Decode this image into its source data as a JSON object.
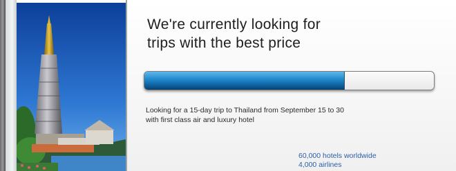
{
  "heading": {
    "line1": "We're currently looking for",
    "line2": "trips with the best price"
  },
  "progress": {
    "fraction": 0.69
  },
  "description": {
    "line1": "Looking for a 15-day trip to Thailand from September 15 to 30",
    "line2": "with first class air and luxury hotel"
  },
  "stats": {
    "hotels": "60,000 hotels worldwide",
    "airlines": "4,000 airlines"
  },
  "colors": {
    "link_blue": "#2c5ea8",
    "progress_blue": "#1f86c9"
  },
  "photo": {
    "icon": "thai-pagoda-photo"
  }
}
